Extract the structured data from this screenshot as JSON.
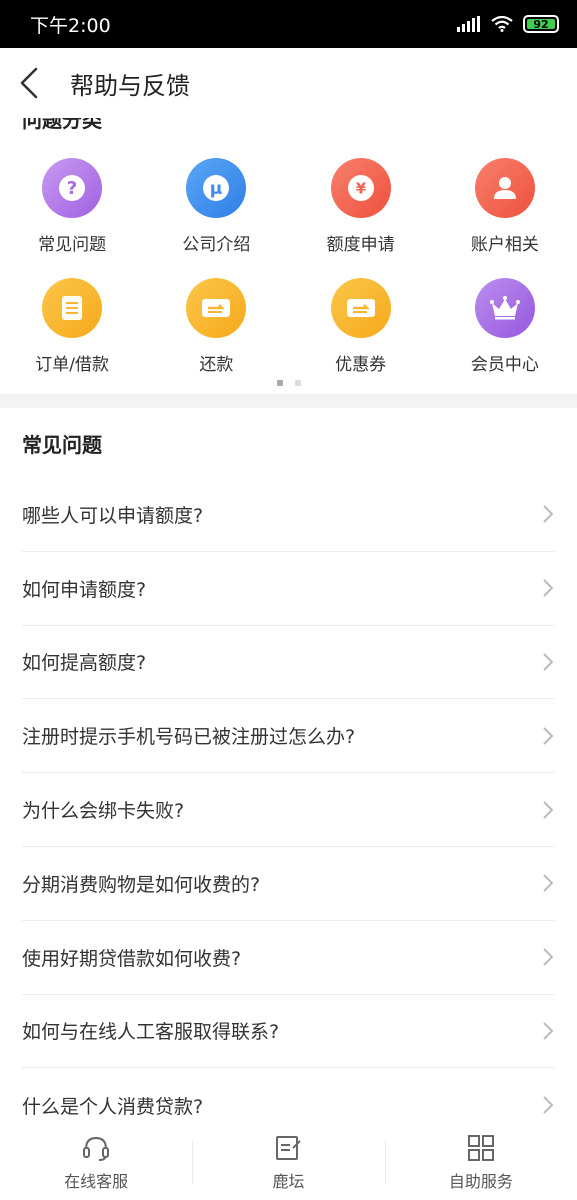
{
  "status_bar": {
    "time": "下午2:00",
    "battery": "92"
  },
  "header": {
    "title": "帮助与反馈"
  },
  "categories": {
    "heading": "问题分类",
    "items": [
      {
        "label": "常见问题",
        "icon": "question-icon",
        "color": "#b57be8"
      },
      {
        "label": "公司介绍",
        "icon": "company-logo-icon",
        "color": "#3d8ef0"
      },
      {
        "label": "额度申请",
        "icon": "yen-icon",
        "color": "#f2634f"
      },
      {
        "label": "账户相关",
        "icon": "user-icon",
        "color": "#f2634f"
      },
      {
        "label": "订单/借款",
        "icon": "document-icon",
        "color": "#f9b52f"
      },
      {
        "label": "还款",
        "icon": "card-icon",
        "color": "#f9b52f"
      },
      {
        "label": "优惠券",
        "icon": "coupon-icon",
        "color": "#f9b52f"
      },
      {
        "label": "会员中心",
        "icon": "crown-icon",
        "color": "#a56be3"
      }
    ]
  },
  "faq": {
    "heading": "常见问题",
    "items": [
      "哪些人可以申请额度?",
      "如何申请额度?",
      "如何提高额度?",
      "注册时提示手机号码已被注册过怎么办?",
      "为什么会绑卡失败?",
      "分期消费购物是如何收费的?",
      "使用好期贷借款如何收费?",
      "如何与在线人工客服取得联系?",
      "什么是个人消费贷款?"
    ]
  },
  "bottom_nav": {
    "items": [
      {
        "label": "在线客服",
        "icon": "headset-icon"
      },
      {
        "label": "鹿坛",
        "icon": "edit-icon"
      },
      {
        "label": "自助服务",
        "icon": "grid-icon"
      }
    ]
  }
}
